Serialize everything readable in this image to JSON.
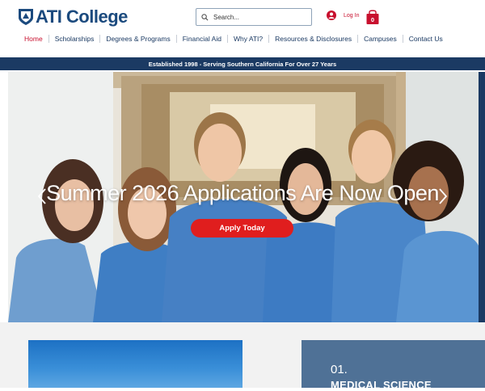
{
  "header": {
    "logo_text": "ATI College",
    "search": {
      "placeholder": "Search..."
    },
    "login_label": "Log In",
    "cart_count": "0"
  },
  "nav": {
    "items": [
      {
        "label": "Home",
        "active": true
      },
      {
        "label": "Scholarships"
      },
      {
        "label": "Degrees & Programs"
      },
      {
        "label": "Financial Aid"
      },
      {
        "label": "Why ATI?"
      },
      {
        "label": "Resources & Disclosures"
      },
      {
        "label": "Campuses"
      },
      {
        "label": "Contact Us"
      }
    ]
  },
  "banner": {
    "text": "Established 1998 - Serving Southern California For Over 27 Years"
  },
  "hero": {
    "title": "Summer 2026 Applications Are Now Open",
    "cta_label": "Apply Today"
  },
  "programs": {
    "first_card": {
      "number": "01.",
      "title": "MEDICAL SCIENCE"
    }
  },
  "colors": {
    "brand_navy": "#1b3a63",
    "accent_red": "#c8102e",
    "cta_red": "#e01e1e",
    "card_blue": "#4f7196"
  }
}
